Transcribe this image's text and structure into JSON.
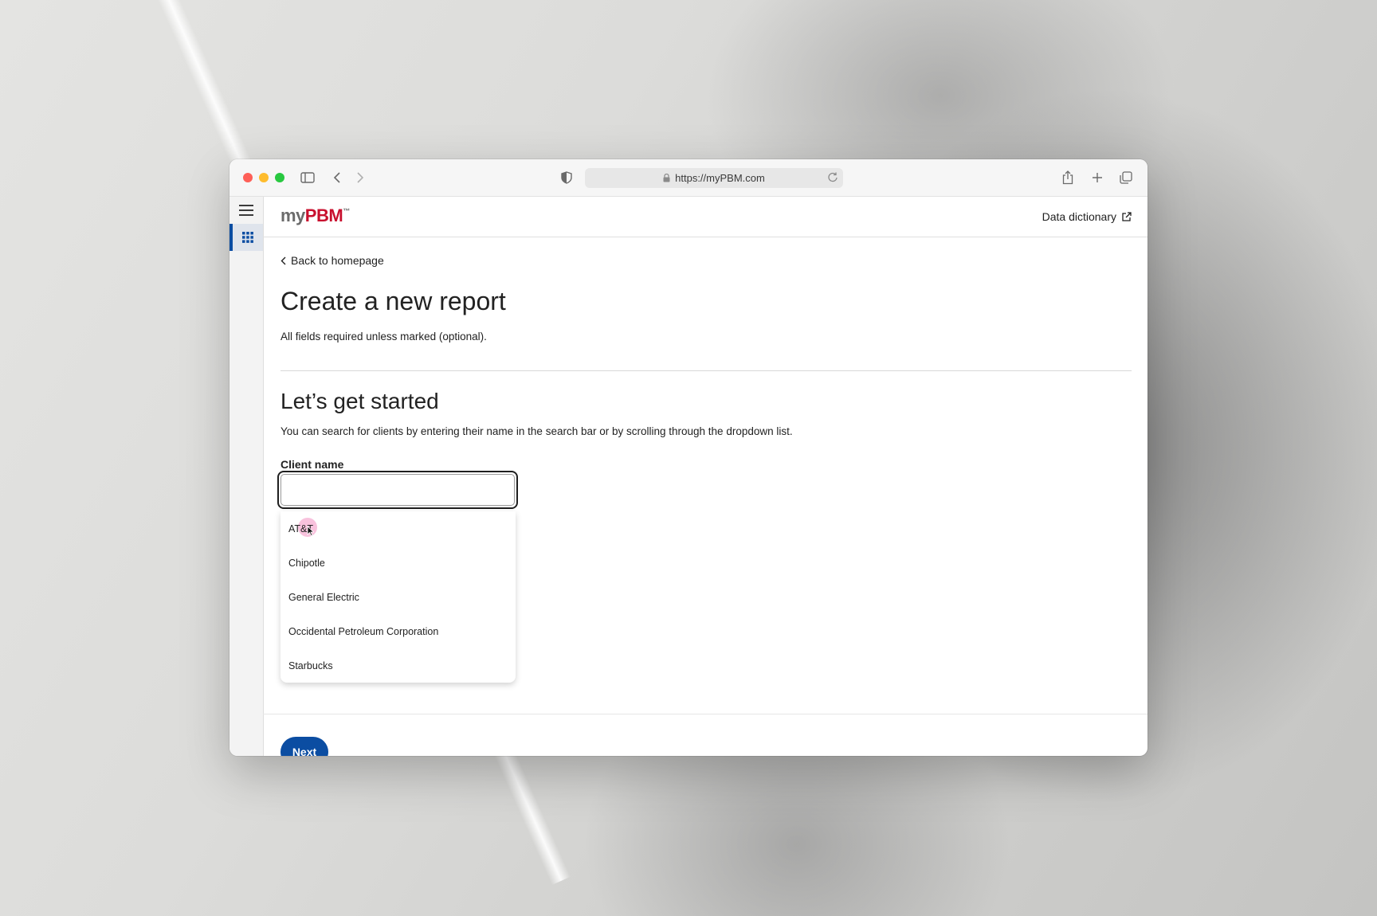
{
  "browser": {
    "url": "https://myPBM.com"
  },
  "app": {
    "logo_my": "my",
    "logo_pbm": "PBM",
    "logo_tm": "™",
    "data_dictionary_label": "Data dictionary"
  },
  "page": {
    "back_label": "Back to homepage",
    "title": "Create a new report",
    "required_note": "All fields required unless marked (optional).",
    "section_title": "Let’s get started",
    "section_description": "You can search for clients by entering their name in the search bar or by scrolling through the dropdown list.",
    "client_field": {
      "label": "Client name",
      "value": "",
      "placeholder": ""
    },
    "client_options": [
      "AT&T",
      "Chipotle",
      "General Electric",
      "Occidental Petroleum Corporation",
      "Starbucks"
    ],
    "next_label": "Next"
  },
  "colors": {
    "accent": "#0b4da2",
    "brand_red": "#c8102e"
  }
}
